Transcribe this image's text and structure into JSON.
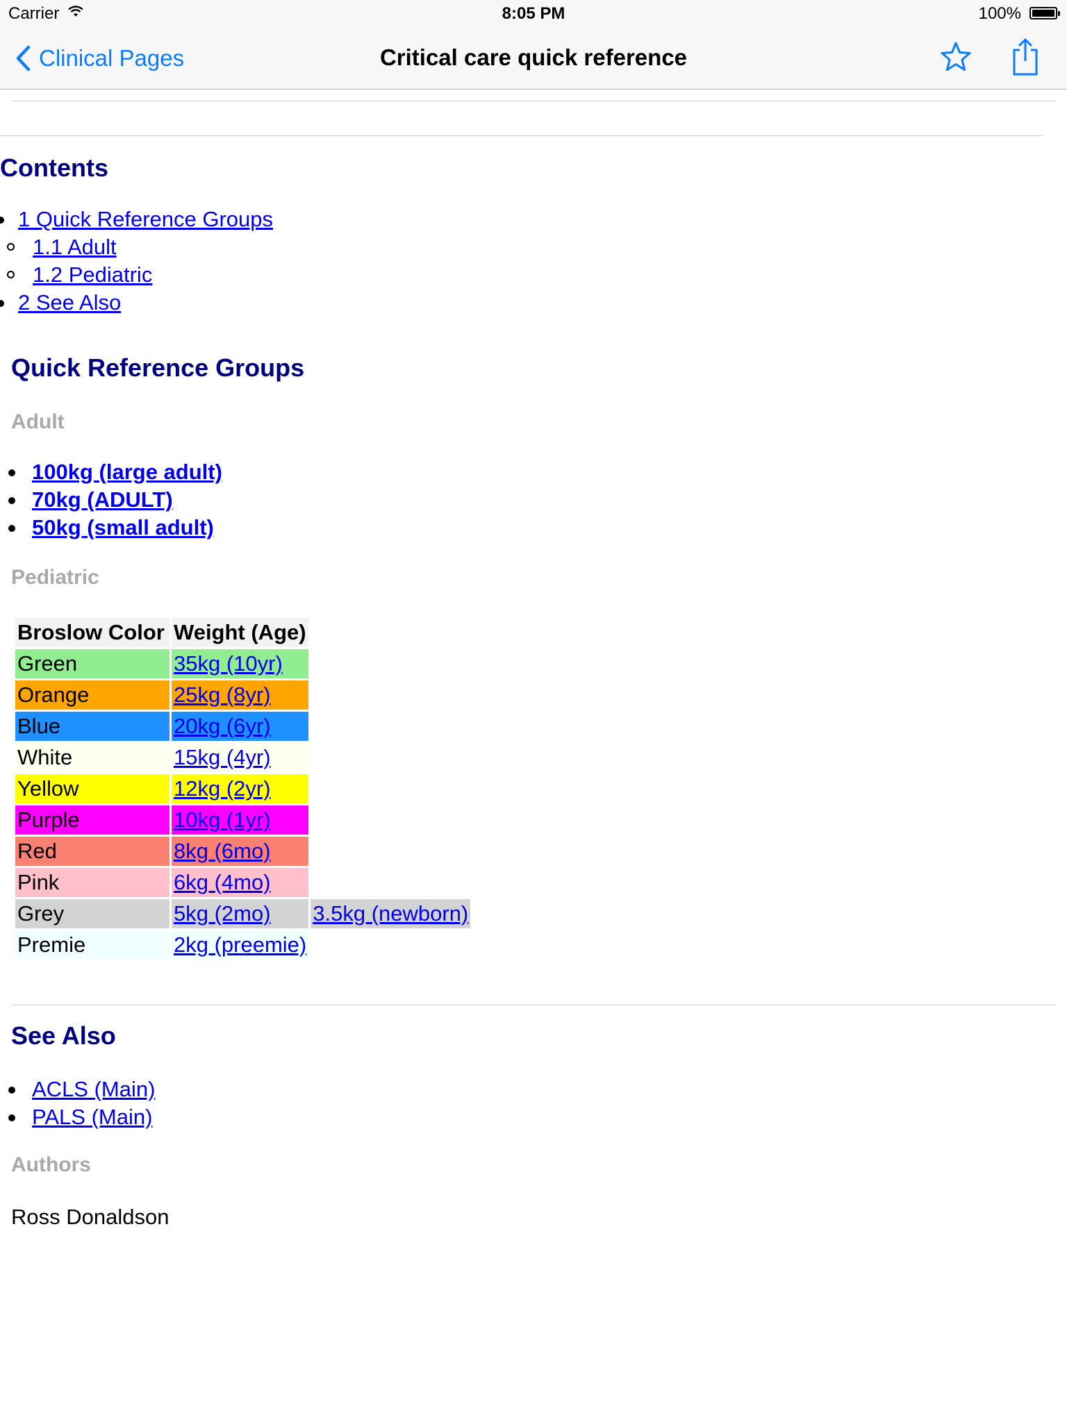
{
  "status_bar": {
    "carrier": "Carrier",
    "time": "8:05 PM",
    "battery": "100%"
  },
  "nav": {
    "back_label": "Clinical Pages",
    "title": "Critical care quick reference",
    "star_icon": "star-outline-icon",
    "share_icon": "share-icon",
    "accent_color": "#0a7cff"
  },
  "toc": {
    "title": "Contents",
    "items": [
      {
        "label": "1 Quick Reference Groups",
        "level": 1
      },
      {
        "label": "1.1 Adult",
        "level": 2
      },
      {
        "label": "1.2 Pediatric",
        "level": 2
      },
      {
        "label": "2 See Also",
        "level": 1
      }
    ]
  },
  "quick_ref": {
    "title": "Quick Reference Groups",
    "adult": {
      "title": "Adult",
      "items": [
        "100kg (large adult)",
        "70kg (ADULT)",
        "50kg (small adult)"
      ]
    },
    "pediatric": {
      "title": "Pediatric",
      "columns": [
        "Broslow Color",
        "Weight (Age)"
      ],
      "rows": [
        {
          "color": "Green",
          "bg": "#90ee90",
          "weights": [
            "35kg (10yr)"
          ]
        },
        {
          "color": "Orange",
          "bg": "#ffa500",
          "weights": [
            "25kg (8yr)"
          ]
        },
        {
          "color": "Blue",
          "bg": "#1e90ff",
          "weights": [
            "20kg (6yr)"
          ]
        },
        {
          "color": "White",
          "bg": "#fffff0",
          "weights": [
            "15kg (4yr)"
          ]
        },
        {
          "color": "Yellow",
          "bg": "#ffff00",
          "weights": [
            "12kg (2yr)"
          ]
        },
        {
          "color": "Purple",
          "bg": "#ff00ff",
          "weights": [
            "10kg (1yr)"
          ]
        },
        {
          "color": "Red",
          "bg": "#fa8072",
          "weights": [
            "8kg (6mo)"
          ]
        },
        {
          "color": "Pink",
          "bg": "#ffc0cb",
          "weights": [
            "6kg (4mo)"
          ]
        },
        {
          "color": "Grey",
          "bg": "#d3d3d3",
          "weights": [
            "5kg (2mo)",
            "3.5kg (newborn)"
          ]
        },
        {
          "color": "Premie",
          "bg": "#f0ffff",
          "weights": [
            "2kg (preemie)"
          ]
        }
      ]
    }
  },
  "see_also": {
    "title": "See Also",
    "items": [
      "ACLS (Main)",
      "PALS (Main)"
    ]
  },
  "authors": {
    "title": "Authors",
    "names": [
      "Ross Donaldson"
    ]
  }
}
